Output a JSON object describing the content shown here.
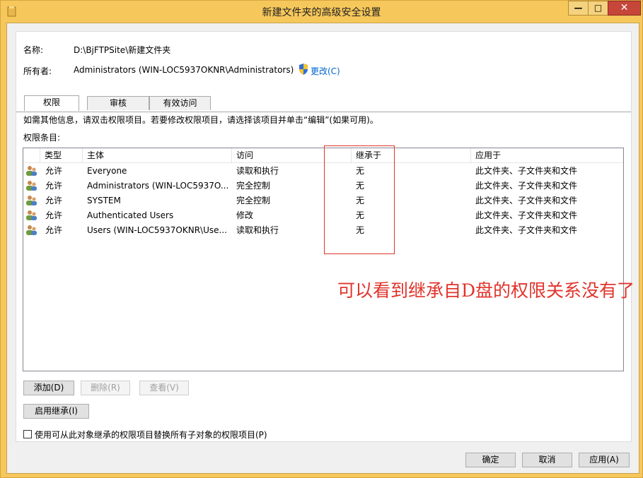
{
  "window": {
    "title": "新建文件夹的高级安全设置"
  },
  "info": {
    "name_label": "名称:",
    "name_value": "D:\\BjFTPSite\\新建文件夹",
    "owner_label": "所有者:",
    "owner_value": "Administrators (WIN-LOC5937OKNR\\Administrators)",
    "change_link": "更改(C)"
  },
  "tabs": [
    {
      "label": "权限",
      "selected": true
    },
    {
      "label": "审核",
      "selected": false
    },
    {
      "label": "有效访问",
      "selected": false
    }
  ],
  "permissions": {
    "hint": "如需其他信息，请双击权限项目。若要修改权限项目，请选择该项目并单击“编辑”(如果可用)。",
    "entries_label": "权限条目:",
    "columns": [
      "类型",
      "主体",
      "访问",
      "继承于",
      "应用于"
    ],
    "rows": [
      {
        "type": "允许",
        "principal": "Everyone",
        "access": "读取和执行",
        "inherited": "无",
        "applies": "此文件夹、子文件夹和文件"
      },
      {
        "type": "允许",
        "principal": "Administrators (WIN-LOC5937O...",
        "access": "完全控制",
        "inherited": "无",
        "applies": "此文件夹、子文件夹和文件"
      },
      {
        "type": "允许",
        "principal": "SYSTEM",
        "access": "完全控制",
        "inherited": "无",
        "applies": "此文件夹、子文件夹和文件"
      },
      {
        "type": "允许",
        "principal": "Authenticated Users",
        "access": "修改",
        "inherited": "无",
        "applies": "此文件夹、子文件夹和文件"
      },
      {
        "type": "允许",
        "principal": "Users (WIN-LOC5937OKNR\\Use...",
        "access": "读取和执行",
        "inherited": "无",
        "applies": "此文件夹、子文件夹和文件"
      }
    ]
  },
  "annotation": "可以看到继承自D盘的权限关系没有了",
  "buttons": {
    "add": "添加(D)",
    "remove": "删除(R)",
    "view": "查看(V)",
    "enable_inheritance": "启用继承(I)",
    "replace_checkbox": "使用可从此对象继承的权限项目替换所有子对象的权限项目(P)",
    "ok": "确定",
    "cancel": "取消",
    "apply": "应用(A)"
  }
}
